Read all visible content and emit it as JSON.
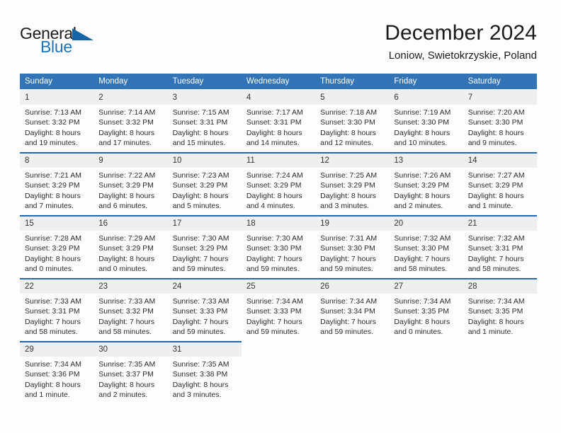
{
  "brand": {
    "name_part1": "General",
    "name_part2": "Blue",
    "logo_icon": "triangle-logo-icon",
    "accent_color": "#1a75bb"
  },
  "header": {
    "month_title": "December 2024",
    "location": "Loniow, Swietokrzyskie, Poland"
  },
  "calendar": {
    "header_bg": "#3274b5",
    "daynum_bg": "#efefef",
    "row_divider_color": "#1f69b3",
    "weekday_headers": [
      "Sunday",
      "Monday",
      "Tuesday",
      "Wednesday",
      "Thursday",
      "Friday",
      "Saturday"
    ],
    "weeks": [
      [
        {
          "day": "1",
          "sunrise": "Sunrise: 7:13 AM",
          "sunset": "Sunset: 3:32 PM",
          "daylight_line1": "Daylight: 8 hours",
          "daylight_line2": "and 19 minutes."
        },
        {
          "day": "2",
          "sunrise": "Sunrise: 7:14 AM",
          "sunset": "Sunset: 3:32 PM",
          "daylight_line1": "Daylight: 8 hours",
          "daylight_line2": "and 17 minutes."
        },
        {
          "day": "3",
          "sunrise": "Sunrise: 7:15 AM",
          "sunset": "Sunset: 3:31 PM",
          "daylight_line1": "Daylight: 8 hours",
          "daylight_line2": "and 15 minutes."
        },
        {
          "day": "4",
          "sunrise": "Sunrise: 7:17 AM",
          "sunset": "Sunset: 3:31 PM",
          "daylight_line1": "Daylight: 8 hours",
          "daylight_line2": "and 14 minutes."
        },
        {
          "day": "5",
          "sunrise": "Sunrise: 7:18 AM",
          "sunset": "Sunset: 3:30 PM",
          "daylight_line1": "Daylight: 8 hours",
          "daylight_line2": "and 12 minutes."
        },
        {
          "day": "6",
          "sunrise": "Sunrise: 7:19 AM",
          "sunset": "Sunset: 3:30 PM",
          "daylight_line1": "Daylight: 8 hours",
          "daylight_line2": "and 10 minutes."
        },
        {
          "day": "7",
          "sunrise": "Sunrise: 7:20 AM",
          "sunset": "Sunset: 3:30 PM",
          "daylight_line1": "Daylight: 8 hours",
          "daylight_line2": "and 9 minutes."
        }
      ],
      [
        {
          "day": "8",
          "sunrise": "Sunrise: 7:21 AM",
          "sunset": "Sunset: 3:29 PM",
          "daylight_line1": "Daylight: 8 hours",
          "daylight_line2": "and 7 minutes."
        },
        {
          "day": "9",
          "sunrise": "Sunrise: 7:22 AM",
          "sunset": "Sunset: 3:29 PM",
          "daylight_line1": "Daylight: 8 hours",
          "daylight_line2": "and 6 minutes."
        },
        {
          "day": "10",
          "sunrise": "Sunrise: 7:23 AM",
          "sunset": "Sunset: 3:29 PM",
          "daylight_line1": "Daylight: 8 hours",
          "daylight_line2": "and 5 minutes."
        },
        {
          "day": "11",
          "sunrise": "Sunrise: 7:24 AM",
          "sunset": "Sunset: 3:29 PM",
          "daylight_line1": "Daylight: 8 hours",
          "daylight_line2": "and 4 minutes."
        },
        {
          "day": "12",
          "sunrise": "Sunrise: 7:25 AM",
          "sunset": "Sunset: 3:29 PM",
          "daylight_line1": "Daylight: 8 hours",
          "daylight_line2": "and 3 minutes."
        },
        {
          "day": "13",
          "sunrise": "Sunrise: 7:26 AM",
          "sunset": "Sunset: 3:29 PM",
          "daylight_line1": "Daylight: 8 hours",
          "daylight_line2": "and 2 minutes."
        },
        {
          "day": "14",
          "sunrise": "Sunrise: 7:27 AM",
          "sunset": "Sunset: 3:29 PM",
          "daylight_line1": "Daylight: 8 hours",
          "daylight_line2": "and 1 minute."
        }
      ],
      [
        {
          "day": "15",
          "sunrise": "Sunrise: 7:28 AM",
          "sunset": "Sunset: 3:29 PM",
          "daylight_line1": "Daylight: 8 hours",
          "daylight_line2": "and 0 minutes."
        },
        {
          "day": "16",
          "sunrise": "Sunrise: 7:29 AM",
          "sunset": "Sunset: 3:29 PM",
          "daylight_line1": "Daylight: 8 hours",
          "daylight_line2": "and 0 minutes."
        },
        {
          "day": "17",
          "sunrise": "Sunrise: 7:30 AM",
          "sunset": "Sunset: 3:29 PM",
          "daylight_line1": "Daylight: 7 hours",
          "daylight_line2": "and 59 minutes."
        },
        {
          "day": "18",
          "sunrise": "Sunrise: 7:30 AM",
          "sunset": "Sunset: 3:30 PM",
          "daylight_line1": "Daylight: 7 hours",
          "daylight_line2": "and 59 minutes."
        },
        {
          "day": "19",
          "sunrise": "Sunrise: 7:31 AM",
          "sunset": "Sunset: 3:30 PM",
          "daylight_line1": "Daylight: 7 hours",
          "daylight_line2": "and 59 minutes."
        },
        {
          "day": "20",
          "sunrise": "Sunrise: 7:32 AM",
          "sunset": "Sunset: 3:30 PM",
          "daylight_line1": "Daylight: 7 hours",
          "daylight_line2": "and 58 minutes."
        },
        {
          "day": "21",
          "sunrise": "Sunrise: 7:32 AM",
          "sunset": "Sunset: 3:31 PM",
          "daylight_line1": "Daylight: 7 hours",
          "daylight_line2": "and 58 minutes."
        }
      ],
      [
        {
          "day": "22",
          "sunrise": "Sunrise: 7:33 AM",
          "sunset": "Sunset: 3:31 PM",
          "daylight_line1": "Daylight: 7 hours",
          "daylight_line2": "and 58 minutes."
        },
        {
          "day": "23",
          "sunrise": "Sunrise: 7:33 AM",
          "sunset": "Sunset: 3:32 PM",
          "daylight_line1": "Daylight: 7 hours",
          "daylight_line2": "and 58 minutes."
        },
        {
          "day": "24",
          "sunrise": "Sunrise: 7:33 AM",
          "sunset": "Sunset: 3:33 PM",
          "daylight_line1": "Daylight: 7 hours",
          "daylight_line2": "and 59 minutes."
        },
        {
          "day": "25",
          "sunrise": "Sunrise: 7:34 AM",
          "sunset": "Sunset: 3:33 PM",
          "daylight_line1": "Daylight: 7 hours",
          "daylight_line2": "and 59 minutes."
        },
        {
          "day": "26",
          "sunrise": "Sunrise: 7:34 AM",
          "sunset": "Sunset: 3:34 PM",
          "daylight_line1": "Daylight: 7 hours",
          "daylight_line2": "and 59 minutes."
        },
        {
          "day": "27",
          "sunrise": "Sunrise: 7:34 AM",
          "sunset": "Sunset: 3:35 PM",
          "daylight_line1": "Daylight: 8 hours",
          "daylight_line2": "and 0 minutes."
        },
        {
          "day": "28",
          "sunrise": "Sunrise: 7:34 AM",
          "sunset": "Sunset: 3:35 PM",
          "daylight_line1": "Daylight: 8 hours",
          "daylight_line2": "and 1 minute."
        }
      ],
      [
        {
          "day": "29",
          "sunrise": "Sunrise: 7:34 AM",
          "sunset": "Sunset: 3:36 PM",
          "daylight_line1": "Daylight: 8 hours",
          "daylight_line2": "and 1 minute."
        },
        {
          "day": "30",
          "sunrise": "Sunrise: 7:35 AM",
          "sunset": "Sunset: 3:37 PM",
          "daylight_line1": "Daylight: 8 hours",
          "daylight_line2": "and 2 minutes."
        },
        {
          "day": "31",
          "sunrise": "Sunrise: 7:35 AM",
          "sunset": "Sunset: 3:38 PM",
          "daylight_line1": "Daylight: 8 hours",
          "daylight_line2": "and 3 minutes."
        },
        {
          "day": "",
          "sunrise": "",
          "sunset": "",
          "daylight_line1": "",
          "daylight_line2": ""
        },
        {
          "day": "",
          "sunrise": "",
          "sunset": "",
          "daylight_line1": "",
          "daylight_line2": ""
        },
        {
          "day": "",
          "sunrise": "",
          "sunset": "",
          "daylight_line1": "",
          "daylight_line2": ""
        },
        {
          "day": "",
          "sunrise": "",
          "sunset": "",
          "daylight_line1": "",
          "daylight_line2": ""
        }
      ]
    ]
  }
}
